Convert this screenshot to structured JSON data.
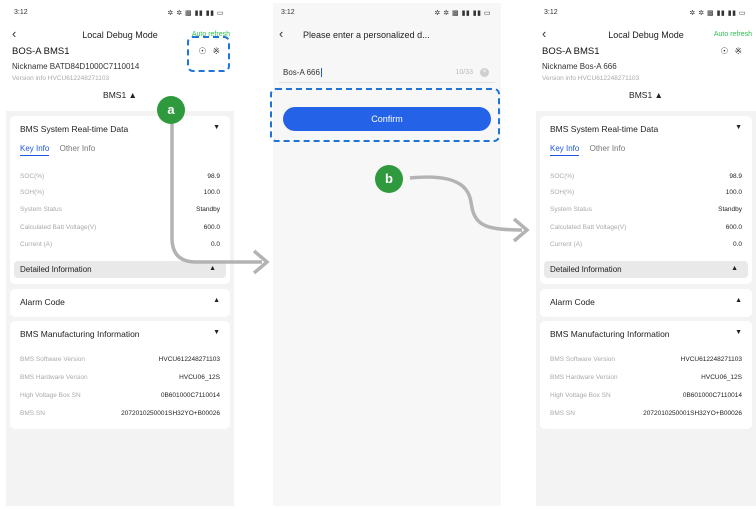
{
  "status": {
    "time": "3:12",
    "icons": "✲ ✲ ▩ ▮▮ ▮▮ ▭"
  },
  "panel1": {
    "nav_title": "Local Debug Mode",
    "auto_refresh": "Auto refresh",
    "device": "BOS-A  BMS1",
    "nickname": "Nickname  BATD84D1000C7110014",
    "version": "Version  info HVCU612248271103",
    "bms_selector": "BMS1 ▲"
  },
  "panel3": {
    "nav_title": "Local Debug Mode",
    "auto_refresh": "Auto refresh",
    "device": "BOS-A  BMS1",
    "nickname": "Nickname  Bos-A  666",
    "version": "Version  info HVCU612248271103",
    "bms_selector": "BMS1 ▲"
  },
  "dialog": {
    "title": "Please enter a personalized d...",
    "input_value": "Bos-A  666",
    "counter": "10/33",
    "confirm": "Confirm"
  },
  "sections": {
    "realtime": "BMS System Real-time Data",
    "tab_key": "Key Info",
    "tab_other": "Other Info",
    "detailed": "Detailed Information",
    "alarm": "Alarm Code",
    "manufacturing": "BMS Manufacturing Information"
  },
  "key_info": [
    {
      "k": "SOC(%)",
      "v": "98.9"
    },
    {
      "k": "SOH(%)",
      "v": "100.0"
    },
    {
      "k": "System Status",
      "v": "Standby"
    },
    {
      "k": "Calculated Batt Voltage(V)",
      "v": "600.0"
    },
    {
      "k": "Current (A)",
      "v": "0.0"
    }
  ],
  "mfg_info": [
    {
      "k": "BMS Software Version",
      "v": "HVCU612248271103"
    },
    {
      "k": "BMS Hardware Version",
      "v": "HVCU06_12S"
    },
    {
      "k": "High Voltage Box SN",
      "v": "0B601000C7110014"
    },
    {
      "k": "BMS SN",
      "v": "2072010250001SH32YO+B00026"
    }
  ],
  "callouts": {
    "a": "a",
    "b": "b"
  },
  "colors": {
    "accent": "#1f57e4",
    "confirm": "#2463e8",
    "badge": "#2e9a3d",
    "dash": "#1f74d6",
    "arrow": "#b3b3b3"
  }
}
